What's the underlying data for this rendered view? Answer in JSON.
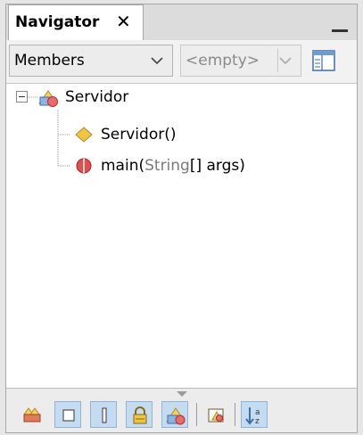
{
  "tab": {
    "title": "Navigator",
    "close_glyph": "✕"
  },
  "filters": {
    "view_mode": "Members",
    "secondary": "<empty>"
  },
  "tree": {
    "root": {
      "label": "Servidor",
      "icon": "class-icon"
    },
    "children": [
      {
        "name": "Servidor",
        "suffix": "()",
        "icon": "constructor-icon"
      },
      {
        "name": "main(",
        "param_type": "String",
        "suffix": "[] args)",
        "icon": "method-icon"
      }
    ]
  },
  "toolbar": {
    "buttons": [
      "inherited-members-icon",
      "fields-toggle-icon",
      "static-toggle-icon",
      "non-public-toggle-icon",
      "class-members-toggle-icon",
      "fqn-icon",
      "sort-az-icon"
    ]
  },
  "colors": {
    "accent": "#c4dcf2",
    "constructor": "#f0c542",
    "method": "#e05050"
  }
}
